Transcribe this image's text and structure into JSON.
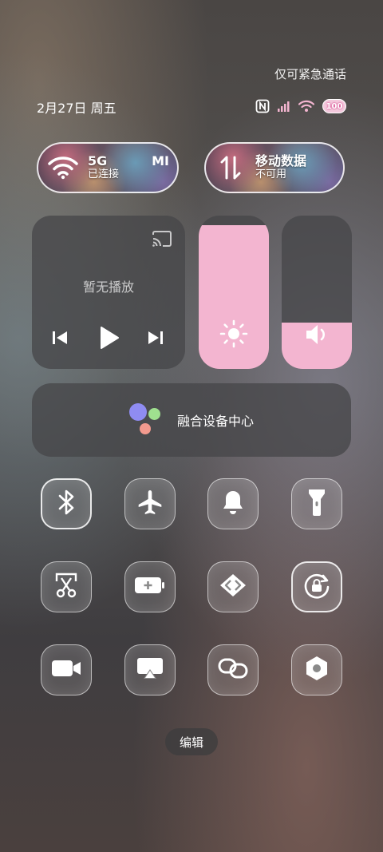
{
  "status": {
    "emergency_text": "仅可紧急通话",
    "date_text": "2月27日 周五",
    "battery": "100"
  },
  "connectivity": {
    "wifi": {
      "title": "5G",
      "subtitle": "已连接",
      "extra": "MI"
    },
    "mobile_data": {
      "title": "移动数据",
      "subtitle": "不可用"
    }
  },
  "media": {
    "no_media_text": "暂无播放"
  },
  "sliders": {
    "brightness_level": 0.94,
    "volume_level": 0.3,
    "fill_color": "#f3b5d0"
  },
  "fusion_center": {
    "label": "融合设备中心"
  },
  "tiles": [
    {
      "icon": "bluetooth-icon",
      "active": true
    },
    {
      "icon": "airplane-icon",
      "active": false
    },
    {
      "icon": "bell-icon",
      "active": false
    },
    {
      "icon": "flashlight-icon",
      "active": false
    },
    {
      "icon": "screenshot-icon",
      "active": false
    },
    {
      "icon": "battery-saver-icon",
      "active": false
    },
    {
      "icon": "code-icon",
      "active": false
    },
    {
      "icon": "rotation-lock-icon",
      "active": true
    },
    {
      "icon": "video-camera-icon",
      "active": false
    },
    {
      "icon": "screen-cast-icon",
      "active": false
    },
    {
      "icon": "link-icon",
      "active": false
    },
    {
      "icon": "settings-hexagon-icon",
      "active": false
    }
  ],
  "edit_button": {
    "label": "编辑"
  }
}
